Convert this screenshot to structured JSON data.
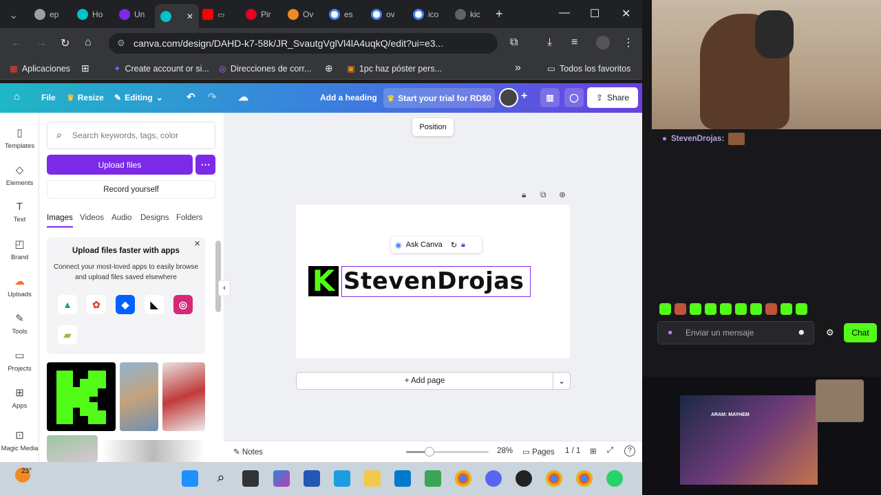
{
  "browser": {
    "tabs": [
      {
        "label": "ep",
        "color": "#9aa0a6"
      },
      {
        "label": "Ho",
        "color": "#00c4cc"
      },
      {
        "label": "Un",
        "color": "#7d2ae8"
      },
      {
        "label": "",
        "color": "#00c4cc"
      },
      {
        "label": "",
        "color": "#ff0000"
      },
      {
        "label": "Pir",
        "color": "#e60023"
      },
      {
        "label": "Ov",
        "color": "#f08a24"
      },
      {
        "label": "es",
        "color": "#4285f4"
      },
      {
        "label": "ov",
        "color": "#4285f4"
      },
      {
        "label": "ico",
        "color": "#4285f4"
      },
      {
        "label": "kic",
        "color": "#9aa0a6"
      }
    ],
    "url": "canva.com/design/DAHD-k7-58k/JR_SvautgVglVl4lA4uqkQ/edit?ui=e3...",
    "bookmarks": [
      "Aplicaciones",
      "Create account or si...",
      "Direcciones de corr...",
      "1pc haz póster pers..."
    ],
    "all_bookmarks": "Todos los favoritos"
  },
  "canva": {
    "menu": {
      "file": "File",
      "resize": "Resize",
      "editing": "Editing"
    },
    "add_heading": "Add a heading",
    "trial": "Start your trial for RD$0",
    "share": "Share",
    "tooltip": "Position",
    "rail": [
      "Templates",
      "Elements",
      "Text",
      "Brand",
      "Uploads",
      "Tools",
      "Projects",
      "Apps",
      "Magic Media"
    ],
    "search_placeholder": "Search keywords, tags, color",
    "upload_files": "Upload files",
    "record_yourself": "Record yourself",
    "panel_tabs": [
      "Images",
      "Videos",
      "Audio",
      "Designs",
      "Folders"
    ],
    "upload_card": {
      "title": "Upload files faster with apps",
      "body": "Connect your most-loved apps to easily browse and upload files saved elsewhere"
    },
    "canvas_text": "StevenDrojas",
    "logo_letter": "K",
    "ask_canva": "Ask Canva",
    "add_page": "+ Add page",
    "footer": {
      "notes": "Notes",
      "zoom": "28%",
      "pages_label": "Pages",
      "page_count": "1 / 1",
      "zoom_fraction": 0.28
    }
  },
  "taskbar": {
    "weather": "23°"
  },
  "stream": {
    "chat_user": "StevenDrojas:",
    "chat_placeholder": "Enviar un mensaje",
    "chat_button": "Chat",
    "game_title": "ARAM: MAYHEM",
    "accent": "#53fc18"
  }
}
